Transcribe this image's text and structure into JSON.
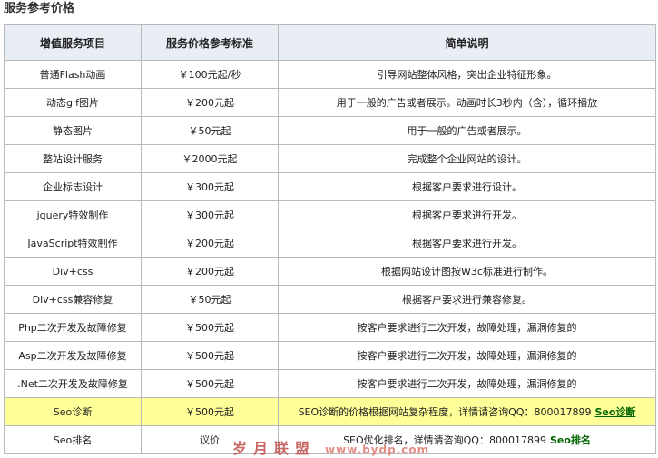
{
  "page": {
    "title": "服务参考价格"
  },
  "table": {
    "headers": [
      "增值服务项目",
      "服务价格参考标准",
      "简单说明"
    ],
    "rows": [
      {
        "item": "普通Flash动画",
        "price": "￥100元起/秒",
        "desc": "引导网站整体风格，突出企业特征形象。"
      },
      {
        "item": "动态gif图片",
        "price": "￥200元起",
        "desc": "用于一般的广告或者展示。动画时长3秒内（含），循环播放"
      },
      {
        "item": "静态图片",
        "price": "￥50元起",
        "desc": "用于一般的广告或者展示。"
      },
      {
        "item": "整站设计服务",
        "price": "￥2000元起",
        "desc": "完成整个企业网站的设计。"
      },
      {
        "item": "企业标志设计",
        "price": "￥300元起",
        "desc": "根据客户要求进行设计。"
      },
      {
        "item": "jquery特效制作",
        "price": "￥300元起",
        "desc": "根据客户要求进行开发。"
      },
      {
        "item": "JavaScript特效制作",
        "price": "￥200元起",
        "desc": "根据客户要求进行开发。"
      },
      {
        "item": "Div+css",
        "price": "￥200元起",
        "desc": "根据网站设计图按W3c标准进行制作。"
      },
      {
        "item": "Div+css兼容修复",
        "price": "￥50元起",
        "desc": "根据客户要求进行兼容修复。"
      },
      {
        "item": "Php二次开发及故障修复",
        "price": "￥500元起",
        "desc": "按客户要求进行二次开发，故障处理，漏洞修复的"
      },
      {
        "item": "Asp二次开发及故障修复",
        "price": "￥500元起",
        "desc": "按客户要求进行二次开发，故障处理，漏洞修复的"
      },
      {
        "item": ".Net二次开发及故障修复",
        "price": "￥500元起",
        "desc": "按客户要求进行二次开发，故障处理，漏洞修复的"
      }
    ],
    "seo_rows": [
      {
        "item": "Seo诊断",
        "price": "￥500元起",
        "desc": "SEO诊断的价格根据网站复杂程度，详情请咨询QQ：800017899",
        "link": "Seo诊断"
      },
      {
        "item": "Seo排名",
        "price": "议价",
        "desc": "SEO优化排名，详情请咨询QQ：800017899",
        "link": "Seo排名"
      }
    ]
  },
  "watermark": {
    "text": "岁月联盟",
    "url": "www.bydp.com"
  },
  "colors": {
    "header_bg": "#e9eef4",
    "highlight_bg": "#ffff99",
    "border": "#b9b9b9",
    "link": "#006600",
    "watermark": "#c0504d"
  }
}
